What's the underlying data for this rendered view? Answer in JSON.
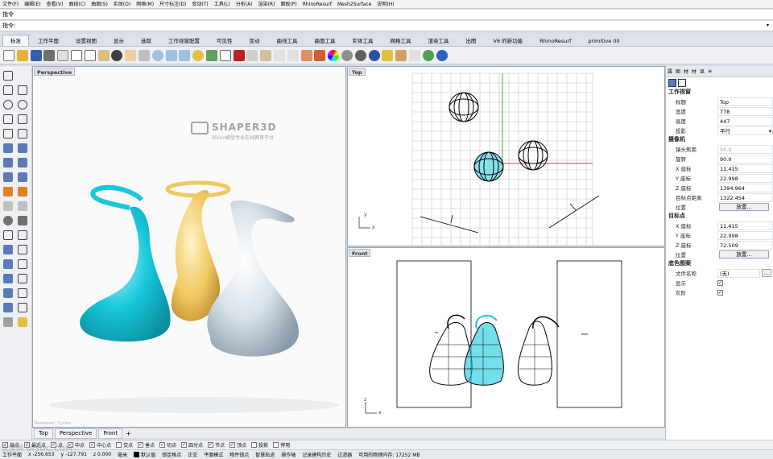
{
  "menu": [
    "文件(F)",
    "编辑(E)",
    "查看(V)",
    "曲线(C)",
    "曲面(S)",
    "实体(O)",
    "网格(M)",
    "尺寸标注(D)",
    "变动(T)",
    "工具(L)",
    "分析(A)",
    "渲染(R)",
    "面板(P)",
    "RhinoResurf",
    "Mesh2Surface",
    "说明(H)"
  ],
  "command": {
    "line1": "指令",
    "line2": "指令:"
  },
  "tabs": [
    "标准",
    "工作平面",
    "设置视图",
    "显示",
    "选取",
    "工作视窗配置",
    "可见性",
    "变动",
    "曲线工具",
    "曲面工具",
    "实体工具",
    "网格工具",
    "渲染工具",
    "出图",
    "V6 的新功能",
    "RhinoResurf",
    "primitive 00"
  ],
  "viewports": {
    "perspective": {
      "label": "Perspective",
      "brand": "SHAPER3D",
      "brand_sub": "Rhino模型专业在线教育平台",
      "caption": "Rendered / Cycles"
    },
    "top": {
      "label": "Top"
    },
    "front": {
      "label": "Front"
    }
  },
  "axis": {
    "x": "x",
    "y": "y",
    "z": "z"
  },
  "viewport_tabs": [
    "Top",
    "Perspective",
    "Front"
  ],
  "osnaps": [
    {
      "label": "端点",
      "checked": true
    },
    {
      "label": "最近点",
      "checked": true
    },
    {
      "label": "点",
      "checked": true
    },
    {
      "label": "中点",
      "checked": true
    },
    {
      "label": "中心点",
      "checked": true
    },
    {
      "label": "交点",
      "checked": false
    },
    {
      "label": "垂点",
      "checked": true
    },
    {
      "label": "切点",
      "checked": true
    },
    {
      "label": "四分点",
      "checked": true
    },
    {
      "label": "节点",
      "checked": true
    },
    {
      "label": "顶点",
      "checked": true
    },
    {
      "label": "投影",
      "checked": false
    },
    {
      "label": "停用",
      "checked": false
    }
  ],
  "status": {
    "cplane": "工作平面",
    "x": "x -256.653",
    "y": "y -127.791",
    "z": "z 0.000",
    "units": "毫米",
    "layer": "默认值",
    "grid_snap": "锁定格点",
    "ortho": "正交",
    "planar": "平面模式",
    "osnap": "物件锁点",
    "smarttrack": "智慧轨迹",
    "gumball": "操作轴",
    "history": "记录建构历史",
    "filter": "过滤器",
    "memory": "可用的物理内存: 17252 MB"
  },
  "panel": {
    "tabs": [
      "属",
      "图",
      "材",
      "材",
      "显",
      "≡"
    ],
    "viewport_section": "工作视窗",
    "title_label": "标题",
    "title_value": "Top",
    "width_label": "宽度",
    "width_value": "778",
    "height_label": "高度",
    "height_value": "447",
    "projection_label": "投影",
    "projection_value": "平行",
    "camera_section": "摄像机",
    "lens_label": "镜头焦距",
    "lens_value": "50.0",
    "rotation_label": "旋转",
    "rotation_value": "90.0",
    "cx_label": "X 座标",
    "cx_value": "11.415",
    "cy_label": "Y 座标",
    "cy_value": "22.998",
    "cz_label": "Z 座标",
    "cz_value": "1394.964",
    "dist_label": "目标点距离",
    "dist_value": "1322.454",
    "pos_label": "位置",
    "pos_button": "放置...",
    "target_section": "目标点",
    "tx_label": "X 座标",
    "tx_value": "11.415",
    "ty_label": "Y 座标",
    "ty_value": "22.998",
    "tz_label": "Z 座标",
    "tz_value": "72.509",
    "tpos_label": "位置",
    "tpos_button": "放置...",
    "wallpaper_section": "底色图案",
    "file_label": "文件名称",
    "file_value": "(无)",
    "file_button": "...",
    "show_label": "显示",
    "gray_label": "灰阶"
  },
  "colors": {
    "accent_cyan": "#18c8dc",
    "gold": "#f0c860",
    "grid": "#c0c4c8",
    "axis_red": "#c00000",
    "axis_green": "#00a000"
  },
  "watermark": "优设网 UISDC.COM"
}
